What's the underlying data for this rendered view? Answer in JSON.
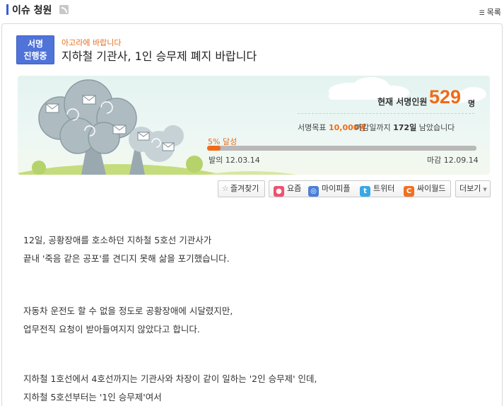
{
  "header": {
    "title": "이슈 청원",
    "list_label": "목록"
  },
  "petition": {
    "badge_line1": "서명",
    "badge_line2": "진행중",
    "source": "아고라에 바랍니다",
    "title": "지하철 기관사, 1인 승무제 폐지 바랍니다",
    "count_label": "현재 서명인원",
    "count_value": "529",
    "count_unit": "명",
    "goal_label": "서명목표",
    "goal_value": "10,000명",
    "deadline_prefix": "마감일까지",
    "deadline_days": "172일",
    "deadline_suffix": "남았습니다",
    "progress_label": "5% 달성",
    "progress_fraction": 0.05,
    "start_label": "발의",
    "start_date": "12.03.14",
    "end_label": "마감",
    "end_date": "12.09.14"
  },
  "share": {
    "favorite": "즐겨찾기",
    "items": [
      {
        "label": "요즘",
        "icon": "yozm-icon",
        "color": "#f0506e"
      },
      {
        "label": "마이피플",
        "icon": "mypeople-icon",
        "color": "#4a7fd6"
      },
      {
        "label": "트위터",
        "icon": "twitter-icon",
        "color": "#3aa8e6"
      },
      {
        "label": "싸이월드",
        "icon": "cyworld-icon",
        "color": "#f36f20"
      }
    ],
    "more": "더보기"
  },
  "body": {
    "paragraphs": [
      [
        "12일, 공황장애를 호소하던 지하철 5호선 기관사가",
        "끝내 '죽음 같은 공포'를 견디지 못해 삶을 포기했습니다."
      ],
      [
        "자동차 운전도 할 수 없을 정도로 공황장애에 시달렸지만,",
        "업무전직 요청이 받아들여지지 않았다고 합니다."
      ],
      [
        "지하철 1호선에서 4호선까지는 기관사와 차장이 같이 일하는 '2인 승무제' 인데,",
        "지하철 5호선부터는 '1인 승무제'여서"
      ]
    ]
  }
}
